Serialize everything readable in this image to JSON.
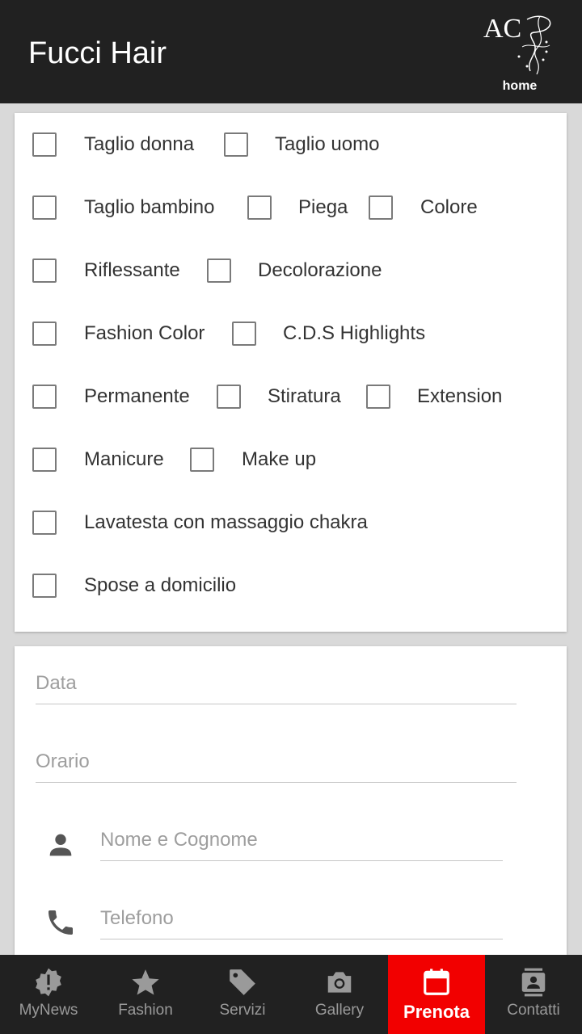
{
  "app": {
    "title": "Fucci Hair",
    "home_label": "home",
    "logo_text": "AC"
  },
  "services": {
    "rows": [
      [
        "Taglio donna",
        "Taglio uomo"
      ],
      [
        "Taglio bambino",
        "Piega",
        "Colore"
      ],
      [
        "Riflessante",
        "Decolorazione"
      ],
      [
        "Fashion Color",
        "C.D.S Highlights"
      ],
      [
        "Permanente",
        "Stiratura",
        "Extension"
      ],
      [
        "Manicure",
        "Make up"
      ],
      [
        "Lavatesta con massaggio chakra"
      ],
      [
        "Spose a domicilio"
      ]
    ]
  },
  "form": {
    "date_placeholder": "Data",
    "time_placeholder": "Orario",
    "name_placeholder": "Nome e Cognome",
    "phone_placeholder": "Telefono"
  },
  "nav": {
    "items": [
      {
        "label": "MyNews",
        "icon": "news-badge-icon"
      },
      {
        "label": "Fashion",
        "icon": "star-icon"
      },
      {
        "label": "Servizi",
        "icon": "tag-icon"
      },
      {
        "label": "Gallery",
        "icon": "camera-icon"
      },
      {
        "label": "Prenota",
        "icon": "calendar-icon"
      },
      {
        "label": "Contatti",
        "icon": "contact-card-icon"
      }
    ],
    "active": "Prenota"
  },
  "colors": {
    "appbar": "#212121",
    "accent": "#f20000",
    "background": "#d9d9d9"
  }
}
